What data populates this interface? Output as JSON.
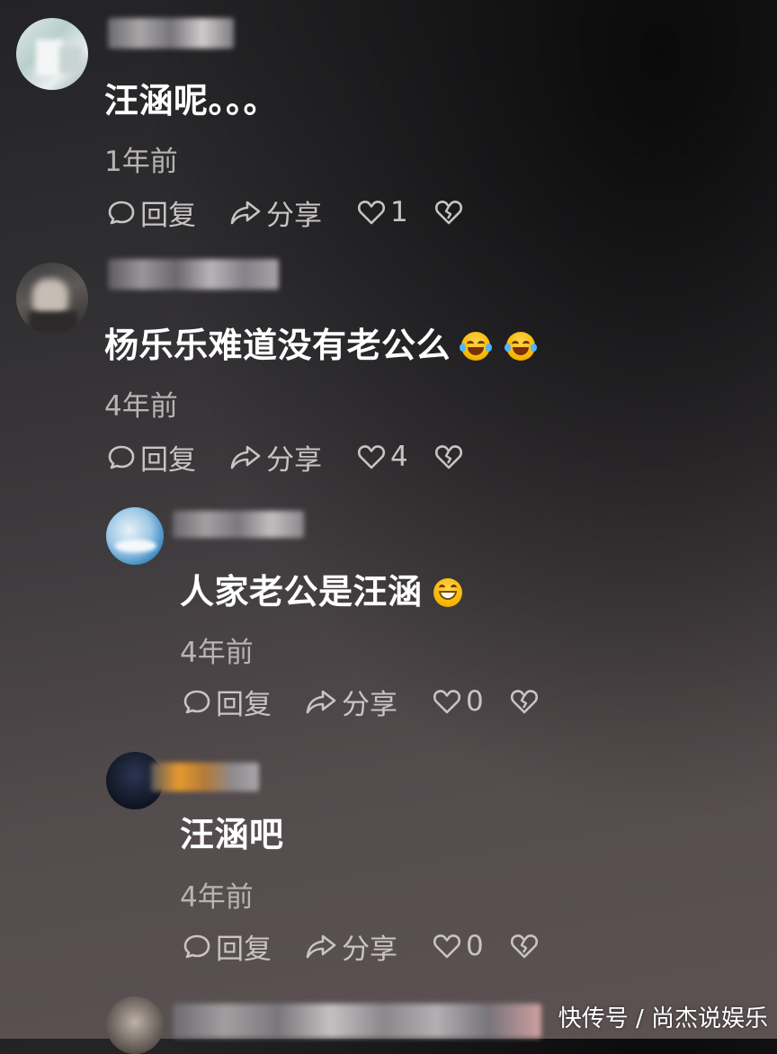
{
  "comments": [
    {
      "text": "汪涵呢。。。",
      "time": "1年前",
      "reply_label": "回复",
      "share_label": "分享",
      "likes": "1"
    },
    {
      "text": "杨乐乐难道没有老公么",
      "time": "4年前",
      "reply_label": "回复",
      "share_label": "分享",
      "likes": "4"
    },
    {
      "text": "人家老公是汪涵",
      "time": "4年前",
      "reply_label": "回复",
      "share_label": "分享",
      "likes": "0"
    },
    {
      "text": "汪涵吧",
      "time": "4年前",
      "reply_label": "回复",
      "share_label": "分享",
      "likes": "0"
    }
  ],
  "watermark": "快传号 / 尚杰说娱乐",
  "icons": {
    "reply": "speech-bubble-icon",
    "share": "share-arrow-icon",
    "like": "heart-outline-icon",
    "dislike": "broken-heart-icon",
    "emoji_laugh": "tears-of-joy-emoji",
    "emoji_grin": "grinning-emoji"
  },
  "colors": {
    "text": "#ffffff",
    "meta": "#b9b4b4",
    "action": "#c9c4c4"
  }
}
